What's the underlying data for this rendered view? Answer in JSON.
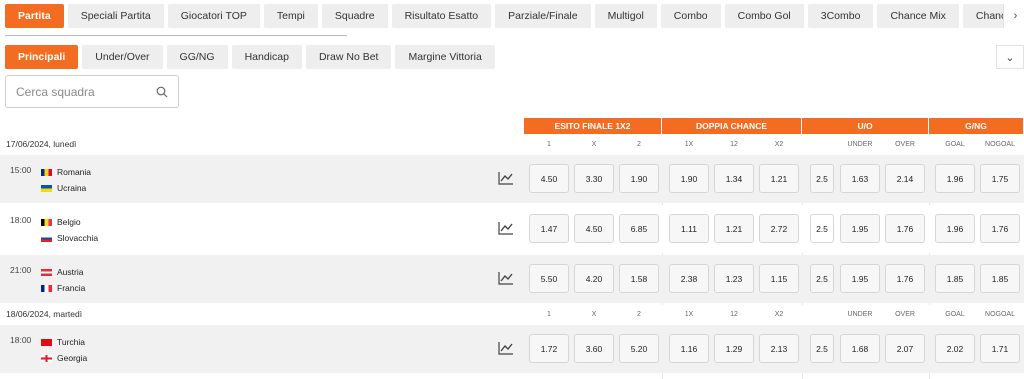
{
  "top_tabs": [
    "Partita",
    "Speciali Partita",
    "Giocatori TOP",
    "Tempi",
    "Squadre",
    "Risultato Esatto",
    "Parziale/Finale",
    "Multigol",
    "Combo",
    "Combo Gol",
    "3Combo",
    "Chance Mix",
    "Chance"
  ],
  "sub_tabs": [
    "Principali",
    "Under/Over",
    "GG/NG",
    "Handicap",
    "Draw No Bet",
    "Margine Vittoria"
  ],
  "search_placeholder": "Cerca squadra",
  "market_headers": [
    "ESITO FINALE 1X2",
    "DOPPIA CHANCE",
    "U/O",
    "G/NG"
  ],
  "col_headers": [
    "1",
    "X",
    "2",
    "1X",
    "12",
    "X2",
    "UNDER",
    "OVER",
    "GOAL",
    "NOGOAL"
  ],
  "colors": {
    "accent": "#f26c21",
    "row_bg": "#f1f1f1"
  },
  "dates": [
    "17/06/2024, lunedì",
    "18/06/2024, martedì"
  ],
  "matches": [
    {
      "time": "15:00",
      "home": "Romania",
      "away": "Ucraina",
      "home_flag": "romania",
      "away_flag": "ukraine",
      "odds": [
        "4.50",
        "3.30",
        "1.90",
        "1.90",
        "1.34",
        "1.21"
      ],
      "line": "2.5",
      "uo": [
        "1.63",
        "2.14"
      ],
      "gng": [
        "1.96",
        "1.75"
      ]
    },
    {
      "time": "18:00",
      "home": "Belgio",
      "away": "Slovacchia",
      "home_flag": "belgium",
      "away_flag": "slovakia",
      "odds": [
        "1.47",
        "4.50",
        "6.85",
        "1.11",
        "1.21",
        "2.72"
      ],
      "line": "2.5",
      "uo": [
        "1.95",
        "1.76"
      ],
      "gng": [
        "1.96",
        "1.76"
      ]
    },
    {
      "time": "21:00",
      "home": "Austria",
      "away": "Francia",
      "home_flag": "austria",
      "away_flag": "france",
      "odds": [
        "5.50",
        "4.20",
        "1.58",
        "2.38",
        "1.23",
        "1.15"
      ],
      "line": "2.5",
      "uo": [
        "1.95",
        "1.76"
      ],
      "gng": [
        "1.85",
        "1.85"
      ]
    },
    {
      "time": "18:00",
      "home": "Turchia",
      "away": "Georgia",
      "home_flag": "turkey",
      "away_flag": "georgia",
      "odds": [
        "1.72",
        "3.60",
        "5.20",
        "1.16",
        "1.29",
        "2.13"
      ],
      "line": "2.5",
      "uo": [
        "1.68",
        "2.07"
      ],
      "gng": [
        "2.02",
        "1.71"
      ]
    }
  ]
}
